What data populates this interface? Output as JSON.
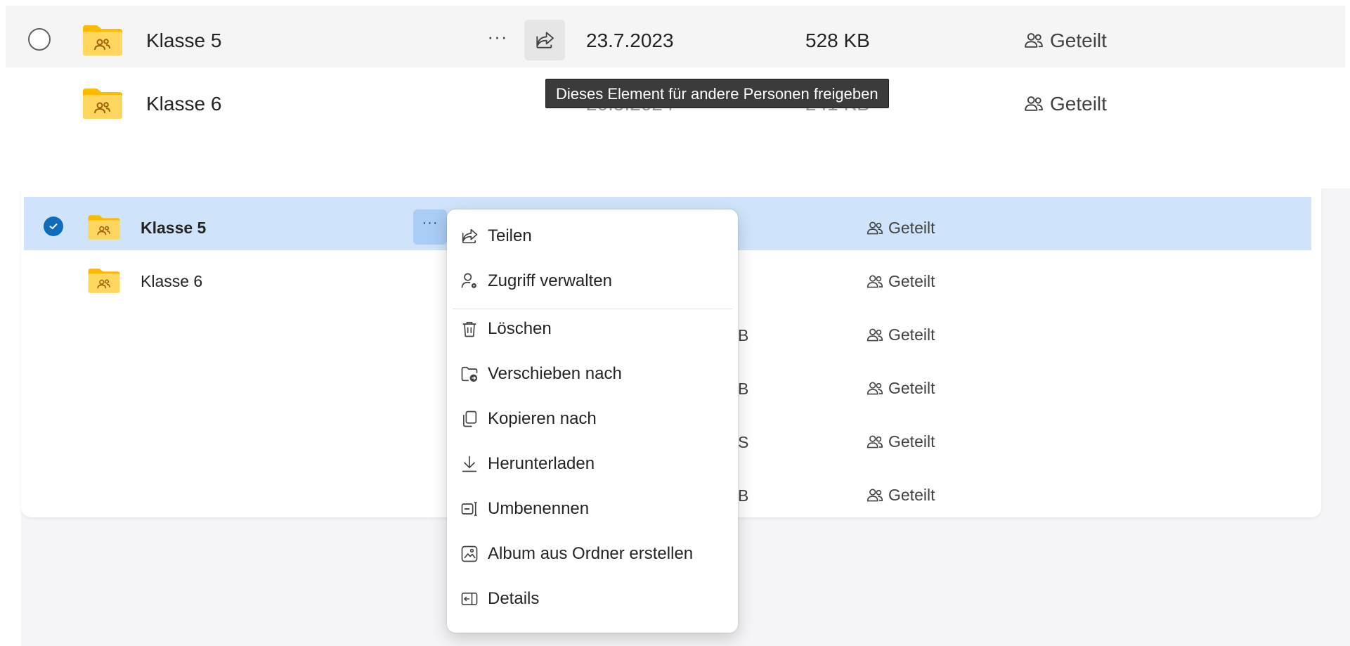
{
  "top_panel": {
    "rows": [
      {
        "name": "Klasse 5",
        "date": "23.7.2023",
        "size": "528 KB",
        "sharing": "Geteilt"
      },
      {
        "name": "Klasse 6",
        "date": "20.5.2024",
        "size": "241 KB",
        "sharing": "Geteilt"
      }
    ],
    "more_label": "···",
    "tooltip": "Dieses Element für andere Personen freigeben"
  },
  "lower_panel": {
    "rows": [
      {
        "name": "Klasse 5",
        "sharing": "Geteilt",
        "selected": true
      },
      {
        "name": "Klasse 6",
        "sharing": "Geteilt",
        "selected": false
      }
    ],
    "other_sharing": [
      "Geteilt",
      "Geteilt",
      "Geteilt",
      "Geteilt"
    ],
    "partial_size_chars": [
      "B",
      "B",
      "S",
      "B"
    ],
    "more_label": "···"
  },
  "context_menu": {
    "items": [
      {
        "label": "Teilen",
        "icon": "share-icon"
      },
      {
        "label": "Zugriff verwalten",
        "icon": "manage-access-icon"
      },
      {
        "label": "Löschen",
        "icon": "trash-icon"
      },
      {
        "label": "Verschieben nach",
        "icon": "move-folder-icon"
      },
      {
        "label": "Kopieren nach",
        "icon": "copy-icon"
      },
      {
        "label": "Herunterladen",
        "icon": "download-icon"
      },
      {
        "label": "Umbenennen",
        "icon": "rename-icon"
      },
      {
        "label": "Album aus Ordner erstellen",
        "icon": "album-icon"
      },
      {
        "label": "Details",
        "icon": "details-icon"
      }
    ]
  },
  "colors": {
    "selection": "#cfe4fa",
    "accent": "#0f6cbd",
    "folder": "#ffc83d",
    "tooltip_bg": "#3b3b3b"
  }
}
